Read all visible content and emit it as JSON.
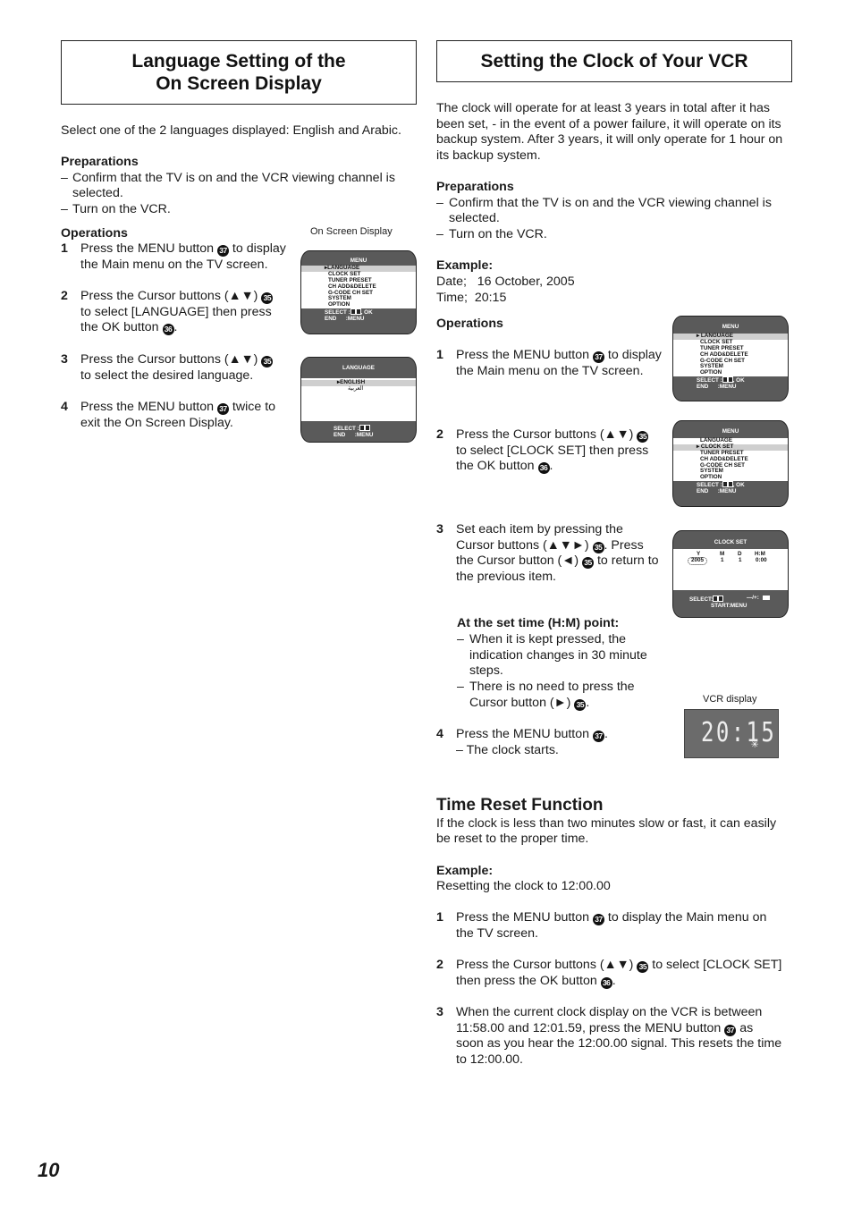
{
  "page_number": "10",
  "left": {
    "title_line1": "Language Setting of the",
    "title_line2": "On Screen Display",
    "intro": "Select one of the 2 languages displayed: English and Arabic.",
    "preparations_heading": "Preparations",
    "preparations": [
      {
        "line1": "Confirm that the TV is on and the VCR viewing channel is",
        "line2": "selected."
      },
      {
        "line1": "Turn on the VCR."
      }
    ],
    "operations_heading": "Operations",
    "steps": [
      {
        "num": "1",
        "parts": [
          "Press the MENU button ",
          "37",
          " to display",
          "the Main menu on the TV screen."
        ]
      },
      {
        "num": "2",
        "parts": [
          "Press the Cursor buttons (▲▼) ",
          "35",
          "to select [LANGUAGE] then press",
          "the OK button ",
          "36",
          "."
        ]
      },
      {
        "num": "3",
        "parts": [
          "Press the Cursor buttons (▲▼) ",
          "35",
          "to select the desired language."
        ]
      },
      {
        "num": "4",
        "parts": [
          "Press the MENU button ",
          "37",
          " twice to",
          "exit the On Screen Display."
        ]
      }
    ],
    "osd_caption": "On Screen Display",
    "menu_screen": {
      "title": "MENU",
      "items": [
        "LANGUAGE",
        "CLOCK SET",
        "TUNER PRESET",
        "CH ADD&DELETE",
        "G-CODE CH SET",
        "SYSTEM",
        "OPTION"
      ],
      "selected": "LANGUAGE",
      "footer1": "SELECT :",
      "footer1b": ", OK",
      "footer2": "END      :MENU"
    },
    "language_screen": {
      "title": "LANGUAGE",
      "items": [
        "ENGLISH",
        "العربية"
      ],
      "selected": "ENGLISH",
      "footer1": "SELECT :",
      "footer2": "END      :MENU"
    }
  },
  "right": {
    "title": "Setting the Clock of Your VCR",
    "intro_lines": [
      "The clock will operate for at least 3 years in total after it has",
      "been set, - in the event of a power failure, it will operate on its",
      "backup system. After 3 years, it will only operate for 1 hour on",
      "its backup system."
    ],
    "preparations_heading": "Preparations",
    "preparations": [
      {
        "line1": "Confirm that the TV is on and the VCR viewing channel is",
        "line2": "selected."
      },
      {
        "line1": "Turn on the VCR."
      }
    ],
    "example_heading": "Example:",
    "example_date": "Date;   16 October, 2005",
    "example_time": "Time;  20:15",
    "operations_heading": "Operations",
    "steps": [
      {
        "num": "1",
        "l1a": "Press the MENU button ",
        "b1": "37",
        "l1b": " to display",
        "l2": "the Main menu on the TV screen."
      },
      {
        "num": "2",
        "l1a": "Press the Cursor buttons (▲▼) ",
        "b1": "35",
        "l2": "to select [CLOCK SET] then press",
        "l3a": "the OK button ",
        "b2": "36",
        "l3b": "."
      },
      {
        "num": "3",
        "l1": "Set each item by pressing the",
        "l2a": "Cursor buttons (▲▼►) ",
        "b1": "35",
        "l2b": ". Press",
        "l3a": "the Cursor button (◄) ",
        "b2": "35",
        "l3b": " to return to",
        "l4": "the previous item."
      },
      {
        "num": "4",
        "l1a": "Press the MENU button ",
        "b1": "37",
        "l1b": ".",
        "l2": "– The clock starts."
      }
    ],
    "hm_note_heading": "At the set time (H:M) point:",
    "hm_notes": [
      {
        "lines": [
          "When it is kept pressed, the",
          "indication changes in 30 minute",
          "steps."
        ]
      },
      {
        "lines": [
          "There is no need to press the",
          "Cursor button (►) "
        ],
        "btn": "35",
        "end": "."
      }
    ],
    "menu_screen_1": {
      "title": "MENU",
      "selected": "LANGUAGE"
    },
    "menu_screen_2": {
      "title": "MENU",
      "selected": "CLOCK SET"
    },
    "menu_items": [
      "LANGUAGE",
      "CLOCK SET",
      "TUNER PRESET",
      "CH ADD&DELETE",
      "G-CODE CH SET",
      "SYSTEM",
      "OPTION"
    ],
    "menu_footer1": "SELECT :",
    "menu_footer1b": ", OK",
    "menu_footer2": "END      :MENU",
    "clock_screen": {
      "title": "CLOCK SET",
      "col_y": "Y",
      "col_m": "M",
      "col_d": "D",
      "col_hm": "H:M",
      "val_y": "2005",
      "val_m": "1",
      "val_d": "1",
      "val_hm": "0:00",
      "footer1": "SELECT:",
      "footer1b": "—/+:",
      "footer2": "START:MENU"
    },
    "vcr_caption": "VCR display",
    "vcr_time": "20:15",
    "time_reset": {
      "heading": "Time Reset Function",
      "intro_lines": [
        "If the clock is less than two minutes slow or fast, it can easily",
        "be reset to the proper time."
      ],
      "example_heading": "Example:",
      "example_text": "Resetting the clock to 12:00.00",
      "steps": [
        {
          "num": "1",
          "l1a": "Press the MENU button ",
          "b1": "37",
          "l1b": " to display the Main menu on",
          "l2": "the TV screen."
        },
        {
          "num": "2",
          "l1a": "Press the Cursor buttons (▲▼) ",
          "b1": "35",
          "l1b": " to select [CLOCK SET]",
          "l2a": "then press the OK button ",
          "b2": "36",
          "l2b": "."
        },
        {
          "num": "3",
          "l1": "When the current clock display on the VCR is between",
          "l2a": "11:58.00 and 12:01.59, press the MENU button ",
          "b1": "37",
          "l2b": " as",
          "l3": "soon as you hear the 12:00.00 signal. This resets the time",
          "l4": "to 12:00.00."
        }
      ]
    }
  }
}
